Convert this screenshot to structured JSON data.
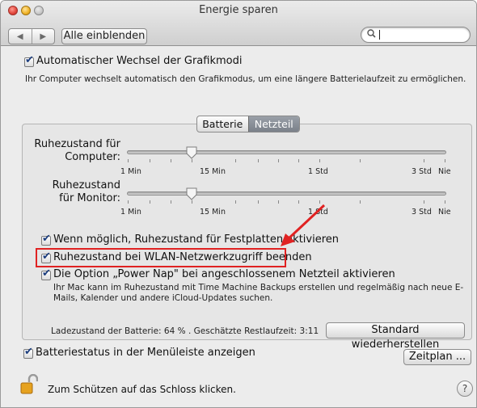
{
  "window": {
    "title": "Energie sparen"
  },
  "toolbar": {
    "back_label": "◀",
    "forward_label": "▶",
    "show_all_label": "Alle einblenden",
    "search_value": "",
    "search_icon": "magnifier-icon"
  },
  "graphics": {
    "switching_label": "Automatischer Wechsel der Grafikmodi",
    "switching_checked": true,
    "switching_desc": "Ihr Computer wechselt automatisch den Grafikmodus, um eine längere Batterielaufzeit zu ermöglichen."
  },
  "tabs": [
    {
      "label": "Batterie",
      "selected": false
    },
    {
      "label": "Netzteil",
      "selected": true
    }
  ],
  "sliders": {
    "computer": {
      "label_line1": "Ruhezustand für",
      "label_line2": "Computer:",
      "value": "15 Min"
    },
    "monitor": {
      "label_line1": "Ruhezustand",
      "label_line2": "für Monitor:",
      "value": "15 Min"
    },
    "tick_labels": [
      "1 Min",
      "15 Min",
      "1 Std",
      "3 Std",
      "Nie"
    ]
  },
  "options": {
    "disk_sleep": {
      "label": "Wenn möglich, Ruhezustand für Festplatten aktivieren",
      "checked": true
    },
    "wake_network": {
      "label": "Ruhezustand bei WLAN-Netzwerkzugriff beenden",
      "checked": true
    },
    "power_nap": {
      "label": "Die Option „Power Nap\" bei angeschlossenem Netzteil aktivieren",
      "checked": true,
      "desc_line1": "Ihr Mac kann im Ruhezustand mit Time Machine Backups erstellen und regelmäßig nach neue E-",
      "desc_line2": "Mails, Kalender und andere iCloud-Updates suchen."
    }
  },
  "battery_status_text": "Ladezustand der Batterie: 64 % . Geschätzte Restlaufzeit: 3:11",
  "restore_label": "Standard wiederherstellen",
  "menubar_option": {
    "label": "Batteriestatus in der Menüleiste anzeigen",
    "checked": true
  },
  "schedule_label": "Zeitplan ...",
  "lock_text": "Zum Schützen auf das Schloss klicken.",
  "help_label": "?",
  "colors": {
    "annotation": "#e02222",
    "checkmark": "#1d3e7e"
  }
}
